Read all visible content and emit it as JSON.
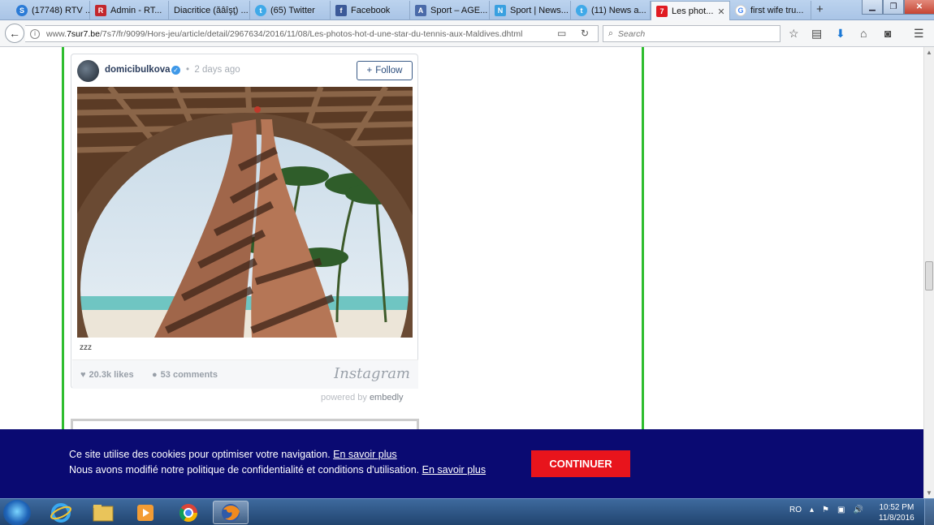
{
  "browser": {
    "tabs": [
      {
        "label": "(17748) RTV ...",
        "icon": "skype-icon",
        "color": "#2b7bd6"
      },
      {
        "label": "Admin - RT...",
        "icon": "rtv-icon",
        "color": "#c2272d"
      },
      {
        "label": "Diacritice (ăâîşţ) ...",
        "icon": "",
        "color": ""
      },
      {
        "label": "(65) Twitter",
        "icon": "twitter-icon",
        "color": "#3fa9e8"
      },
      {
        "label": "Facebook",
        "icon": "facebook-icon",
        "color": "#3b5998"
      },
      {
        "label": "Sport – AGE...",
        "icon": "agerpres-icon",
        "color": "#4a6aa8"
      },
      {
        "label": "Sport | News...",
        "icon": "news-icon",
        "color": "#39a0e0"
      },
      {
        "label": "(11) News a...",
        "icon": "twitter-icon",
        "color": "#3fa9e8"
      },
      {
        "label": "Les phot...",
        "icon": "7sur7-icon",
        "color": "#e01b22",
        "active": true,
        "close": "✕"
      },
      {
        "label": "first wife tru...",
        "icon": "google-icon",
        "color": "#4285f4"
      }
    ],
    "new_tab": "+",
    "url": {
      "prefix": "www.",
      "domain": "7sur7.be",
      "path": "/7s7/fr/9099/Hors-jeu/article/detail/2967634/2016/11/08/Les-photos-hot-d-une-star-du-tennis-aux-Maldives.dhtml"
    },
    "search_placeholder": "Search"
  },
  "post": {
    "username": "domicibulkova",
    "dot": "•",
    "time_ago": "2 days ago",
    "follow_label": "Follow",
    "caption": "zzz",
    "likes": "20.3k likes",
    "comments": "53 comments",
    "brand": "Instagram",
    "powered_prefix": "powered by",
    "powered_brand": "embedly"
  },
  "cookie": {
    "line1_text": "Ce site utilise des cookies pour optimiser votre navigation.",
    "line1_link": "En savoir plus",
    "line2_text": "Nous avons modifié notre politique de confidentialité et conditions d'utilisation.",
    "line2_link": "En savoir plus",
    "button": "CONTINUER"
  },
  "taskbar": {
    "apps": [
      "internet-explorer-icon",
      "explorer-icon",
      "media-player-icon",
      "chrome-icon",
      "firefox-icon"
    ],
    "language": "RO",
    "time": "10:52 PM",
    "date": "11/8/2016"
  },
  "colors": {
    "accent_green": "#2fbd2f",
    "cookie_bg": "#0a0a72",
    "button_red": "#e8141c"
  }
}
